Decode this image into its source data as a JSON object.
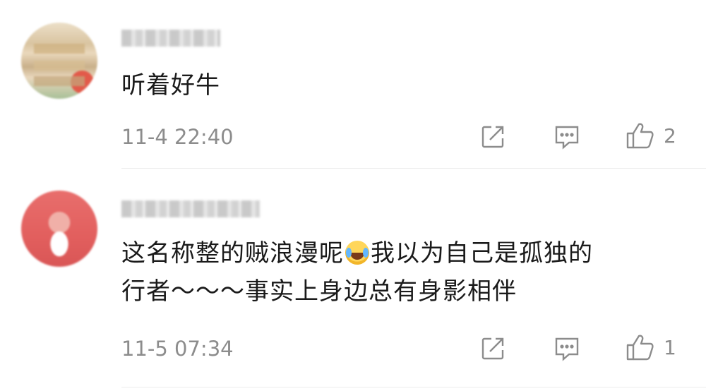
{
  "comments": [
    {
      "text": "听着好牛",
      "time": "11-4 22:40",
      "likes": "2",
      "icons": [
        "share-icon",
        "reply-icon",
        "like-icon"
      ]
    },
    {
      "text_part1": "这名称整的贼浪漫呢",
      "text_part2": "我以为自己是孤独的",
      "text_line2": "行者～～～事实上身边总有身影相伴",
      "emoji": "laugh-cry-emoji",
      "time": "11-5 07:34",
      "likes": "1",
      "icons": [
        "share-icon",
        "reply-icon",
        "like-icon"
      ]
    }
  ]
}
